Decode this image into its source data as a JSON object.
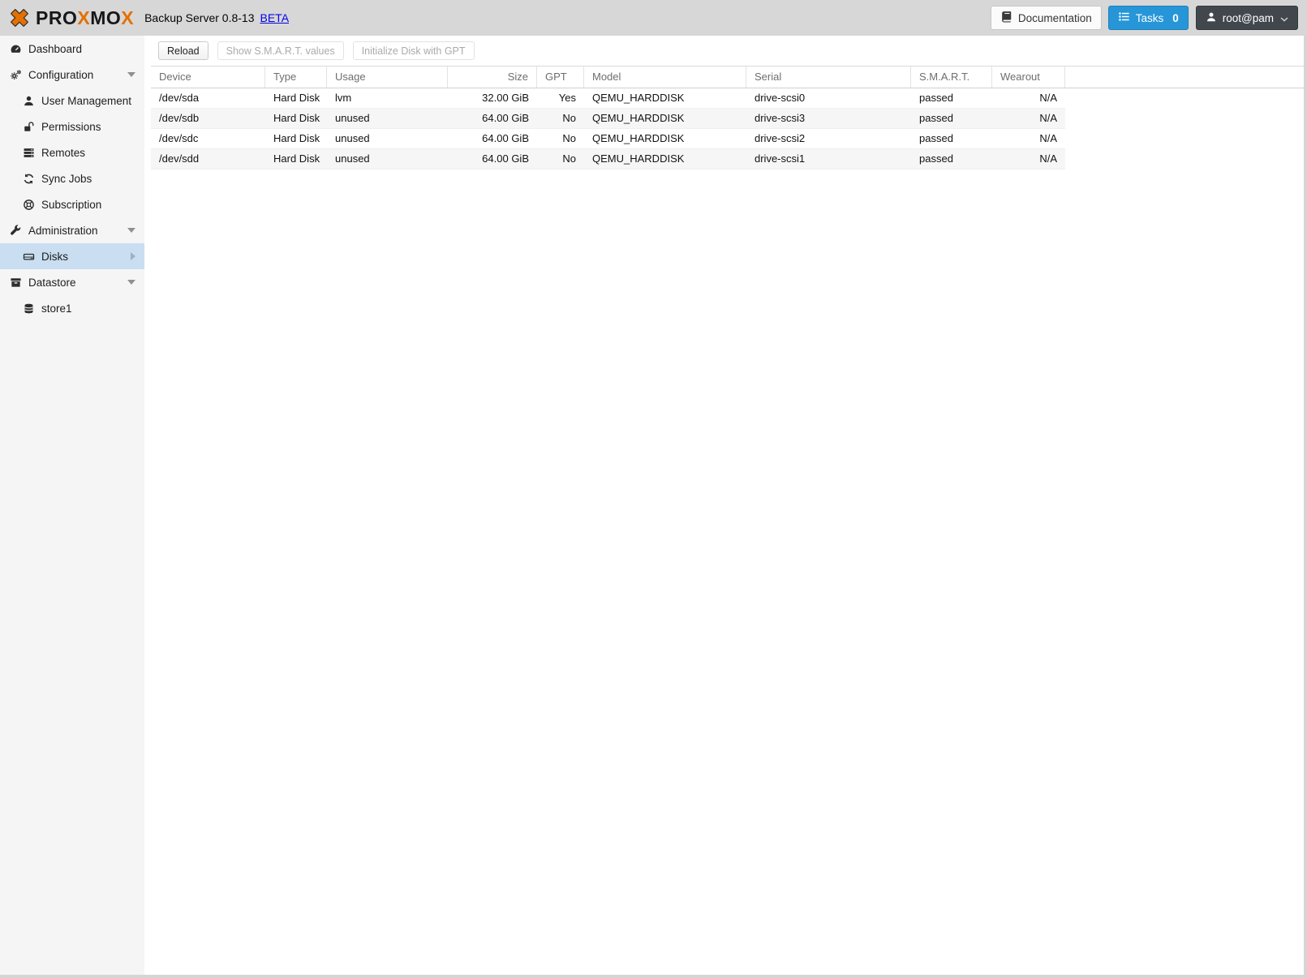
{
  "header": {
    "brand": {
      "part1": "PRO",
      "x1": "X",
      "part2": "MO",
      "x2": "X"
    },
    "title": "Backup Server 0.8-13",
    "beta": "BETA",
    "documentation": "Documentation",
    "tasks": "Tasks",
    "tasks_count": "0",
    "user": "root@pam"
  },
  "sidebar": {
    "items": [
      {
        "label": "Dashboard",
        "icon": "dashboard-icon",
        "level": 0
      },
      {
        "label": "Configuration",
        "icon": "gears-icon",
        "level": 0,
        "expanded": true
      },
      {
        "label": "User Management",
        "icon": "user-icon",
        "level": 1
      },
      {
        "label": "Permissions",
        "icon": "unlock-icon",
        "level": 1
      },
      {
        "label": "Remotes",
        "icon": "server-icon",
        "level": 1
      },
      {
        "label": "Sync Jobs",
        "icon": "sync-icon",
        "level": 1
      },
      {
        "label": "Subscription",
        "icon": "life-ring-icon",
        "level": 1
      },
      {
        "label": "Administration",
        "icon": "wrench-icon",
        "level": 0,
        "expanded": true
      },
      {
        "label": "Disks",
        "icon": "hdd-icon",
        "level": 1,
        "selected": true,
        "has_children": true
      },
      {
        "label": "Datastore",
        "icon": "archive-icon",
        "level": 0,
        "expanded": true
      },
      {
        "label": "store1",
        "icon": "database-icon",
        "level": 1
      }
    ]
  },
  "toolbar": {
    "reload": "Reload",
    "show_smart": "Show S.M.A.R.T. values",
    "init_gpt": "Initialize Disk with GPT"
  },
  "table": {
    "columns": [
      "Device",
      "Type",
      "Usage",
      "Size",
      "GPT",
      "Model",
      "Serial",
      "S.M.A.R.T.",
      "Wearout"
    ],
    "rows": [
      {
        "device": "/dev/sda",
        "type": "Hard Disk",
        "usage": "lvm",
        "size": "32.00 GiB",
        "gpt": "Yes",
        "model": "QEMU_HARDDISK",
        "serial": "drive-scsi0",
        "smart": "passed",
        "wearout": "N/A"
      },
      {
        "device": "/dev/sdb",
        "type": "Hard Disk",
        "usage": "unused",
        "size": "64.00 GiB",
        "gpt": "No",
        "model": "QEMU_HARDDISK",
        "serial": "drive-scsi3",
        "smart": "passed",
        "wearout": "N/A"
      },
      {
        "device": "/dev/sdc",
        "type": "Hard Disk",
        "usage": "unused",
        "size": "64.00 GiB",
        "gpt": "No",
        "model": "QEMU_HARDDISK",
        "serial": "drive-scsi2",
        "smart": "passed",
        "wearout": "N/A"
      },
      {
        "device": "/dev/sdd",
        "type": "Hard Disk",
        "usage": "unused",
        "size": "64.00 GiB",
        "gpt": "No",
        "model": "QEMU_HARDDISK",
        "serial": "drive-scsi1",
        "smart": "passed",
        "wearout": "N/A"
      }
    ]
  },
  "colors": {
    "accent_blue": "#2696d8",
    "logo_orange": "#e57000",
    "nav_selected_bg": "#c9def1",
    "link_blue": "#0404e8",
    "user_button_bg": "#41474d"
  }
}
